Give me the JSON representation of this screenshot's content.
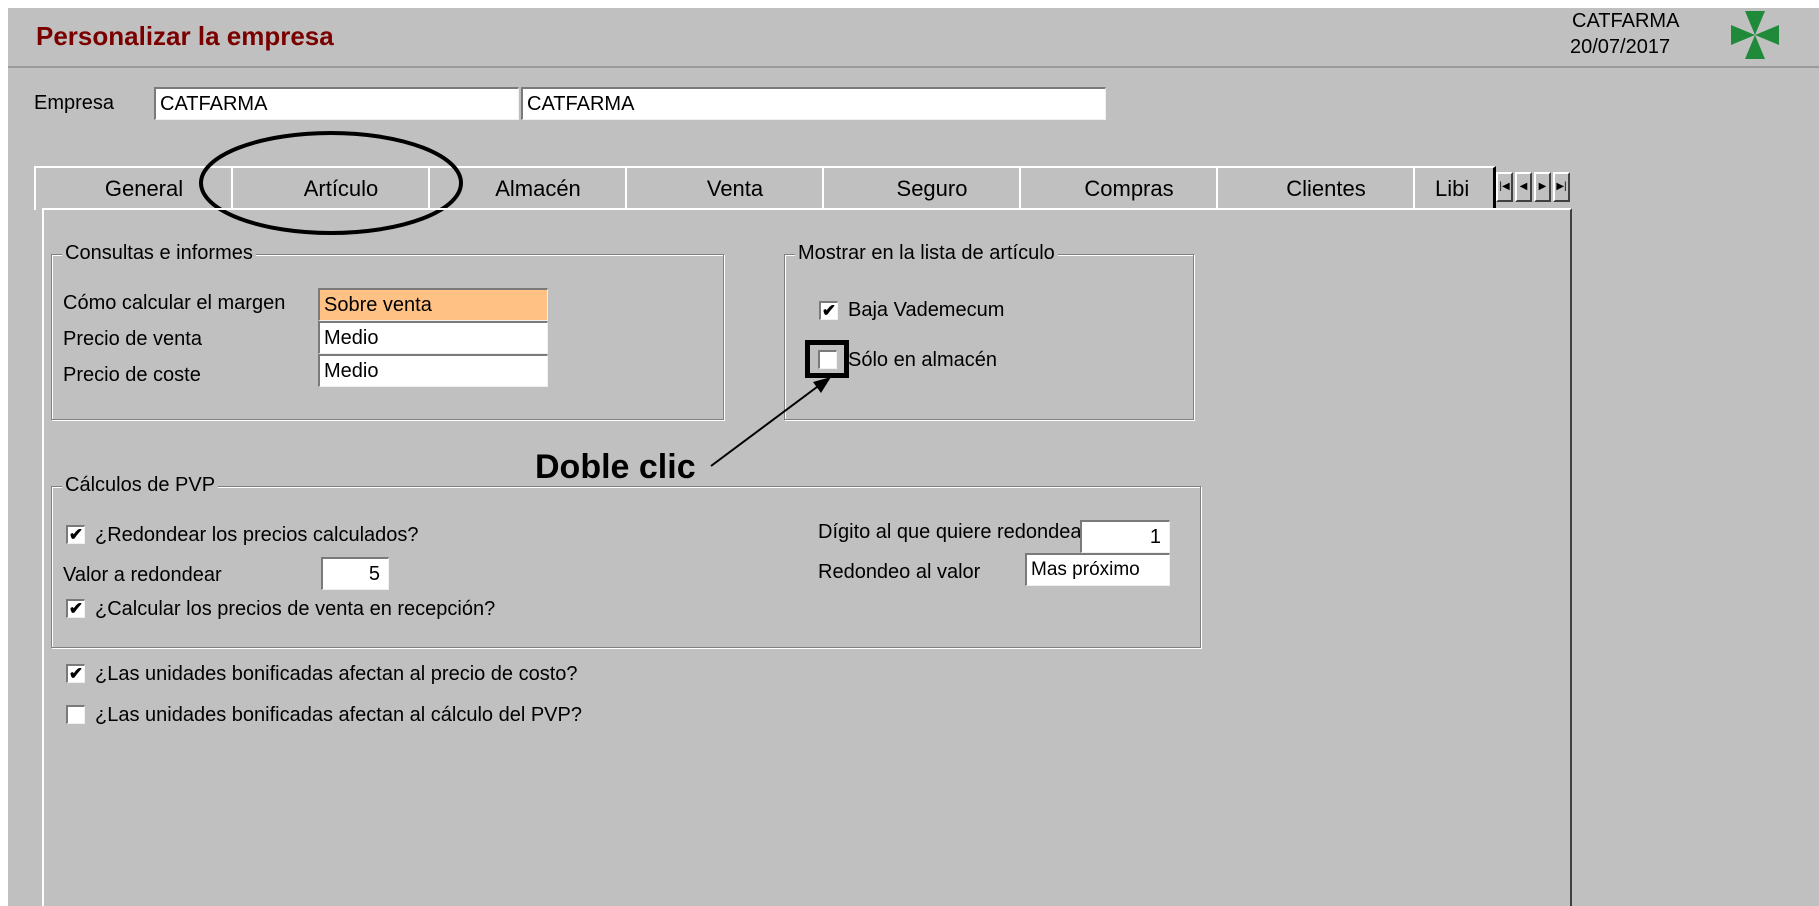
{
  "window": {
    "title": "Personalizar la empresa",
    "company_name": "CATFARMA",
    "date": "20/07/2017"
  },
  "empresa": {
    "label": "Empresa",
    "code": "CATFARMA",
    "name": "CATFARMA"
  },
  "tabs": [
    {
      "label": "General"
    },
    {
      "label": "Artículo",
      "active": true
    },
    {
      "label": "Almacén"
    },
    {
      "label": "Venta"
    },
    {
      "label": "Seguro"
    },
    {
      "label": "Compras"
    },
    {
      "label": "Clientes"
    },
    {
      "label": "Libi"
    }
  ],
  "tab_nav_icons": [
    "first-icon",
    "prev-icon",
    "next-icon",
    "last-icon"
  ],
  "consultas": {
    "title": "Consultas e informes",
    "margin_label": "Cómo calcular el margen",
    "margin_value": "Sobre venta",
    "sale_price_label": "Precio de venta",
    "sale_price_value": "Medio",
    "cost_price_label": "Precio de coste",
    "cost_price_value": "Medio"
  },
  "mostrar": {
    "title": "Mostrar en la lista de artículo",
    "baja_label": "Baja Vademecum",
    "baja_checked": true,
    "almacen_label": "Sólo en almacén",
    "almacen_checked": false
  },
  "calculos": {
    "title": "Cálculos de PVP",
    "redondear_label": "¿Redondear los precios calculados?",
    "redondear_checked": true,
    "valor_label": "Valor a redondear",
    "valor_value": "5",
    "recepcion_label": "¿Calcular los precios de venta en recepción?",
    "recepcion_checked": true,
    "digito_label": "Dígito al que quiere redondear",
    "digito_value": "1",
    "redondeo_label": "Redondeo al valor",
    "redondeo_value": "Mas próximo"
  },
  "bonificadas": {
    "costo_label": "¿Las unidades bonificadas afectan al precio de costo?",
    "costo_checked": true,
    "pvp_label": "¿Las unidades bonificadas afectan al cálculo del PVP?",
    "pvp_checked": false
  },
  "annotation": {
    "text": "Doble clic"
  },
  "check_mark": "✔",
  "colors": {
    "title": "#7a0000",
    "highlight_field": "#ffc184",
    "logo_green": "#1f8a3a"
  }
}
